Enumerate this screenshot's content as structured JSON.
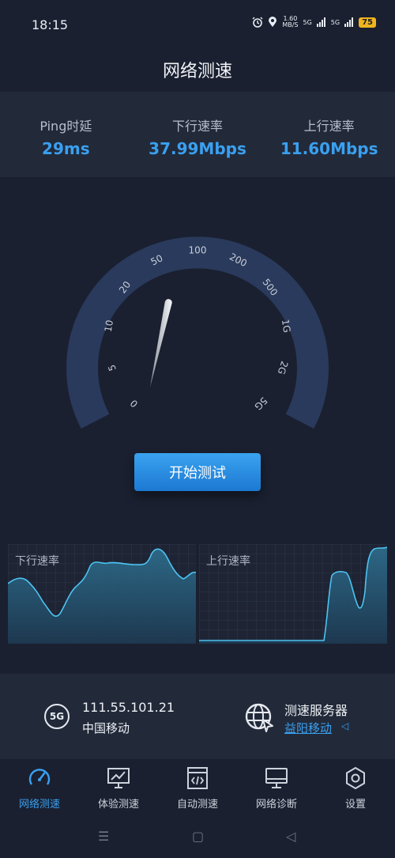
{
  "status": {
    "time": "18:15",
    "net_speed": "1.60",
    "net_unit": "MB/S",
    "sig1": "5G",
    "sig2": "5G",
    "battery": "75"
  },
  "page_title": "网络测速",
  "stats": [
    {
      "label": "Ping时延",
      "value": "29ms"
    },
    {
      "label": "下行速率",
      "value": "37.99Mbps"
    },
    {
      "label": "上行速率",
      "value": "11.60Mbps"
    }
  ],
  "gauge": {
    "ticks": [
      "0",
      "5",
      "10",
      "20",
      "50",
      "100",
      "200",
      "500",
      "1G",
      "2G",
      "5G"
    ],
    "needle_value_mbps": 37.99
  },
  "start_button": "开始测试",
  "charts": {
    "download_label": "下行速率",
    "upload_label": "上行速率"
  },
  "network_info": {
    "badge": "5G",
    "ip": "111.55.101.21",
    "carrier": "中国移动"
  },
  "server": {
    "title": "测速服务器",
    "name": "益阳移动",
    "caret": "◁"
  },
  "tabs": [
    {
      "label": "网络测速",
      "icon": "speedometer-icon",
      "active": true
    },
    {
      "label": "体验测速",
      "icon": "monitor-chart-icon",
      "active": false
    },
    {
      "label": "自动测速",
      "icon": "code-window-icon",
      "active": false
    },
    {
      "label": "网络诊断",
      "icon": "monitor-icon",
      "active": false
    },
    {
      "label": "设置",
      "icon": "hexagon-settings-icon",
      "active": false
    }
  ],
  "nav": {
    "menu": "☰",
    "home": "▢",
    "back": "◁"
  },
  "colors": {
    "accent": "#3aa0f0",
    "background": "#1a2030",
    "panel": "#222a3a"
  }
}
